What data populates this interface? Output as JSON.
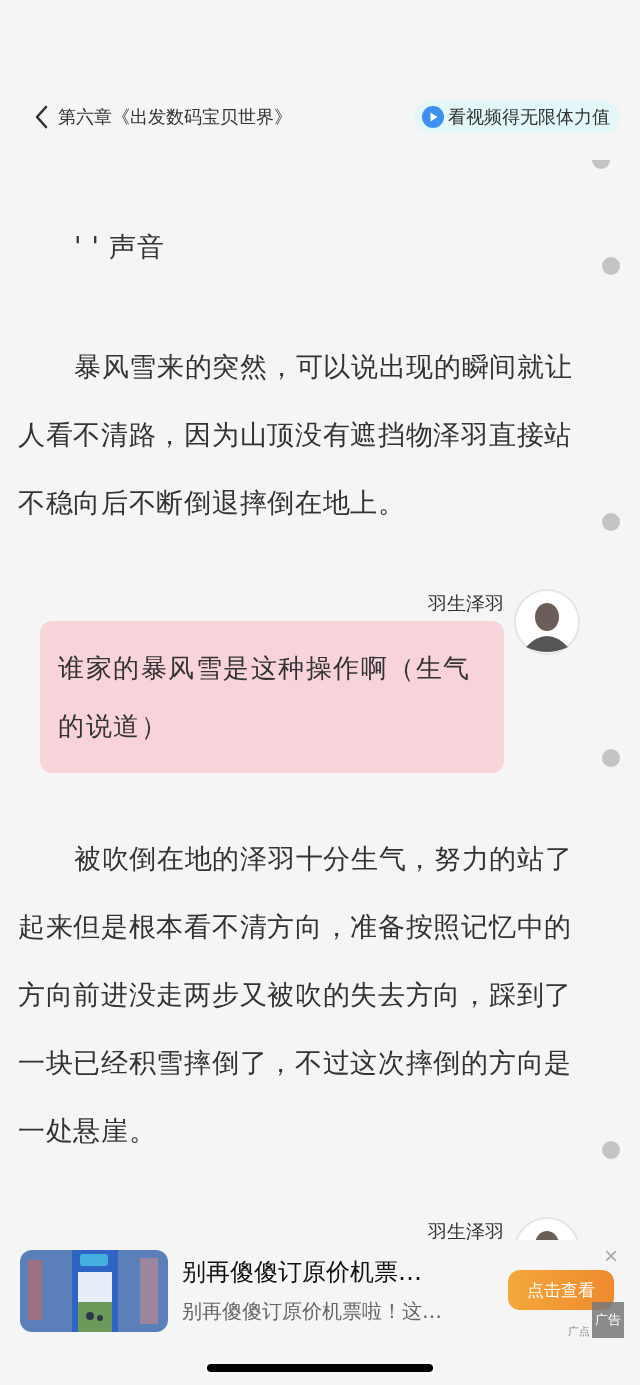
{
  "header": {
    "chapter_title": "第六章《出发数码宝贝世界》",
    "reward_button": "看视频得无限体力值"
  },
  "blocks": [
    {
      "kind": "paragraph",
      "text": "' ' 声音"
    },
    {
      "kind": "paragraph",
      "text": "暴风雪来的突然，可以说出现的瞬间就让人看不清路，因为山顶没有遮挡物泽羽直接站不稳向后不断倒退摔倒在地上。"
    },
    {
      "kind": "dialog",
      "speaker": "羽生泽羽",
      "text": "谁家的暴风雪是这种操作啊（生气的说道）"
    },
    {
      "kind": "paragraph",
      "text": "被吹倒在地的泽羽十分生气，努力的站了起来但是根本看不清方向，准备按照记忆中的方向前进没走两步又被吹的失去方向，踩到了一块已经积雪摔倒了，不过这次摔倒的方向是一处悬崖。"
    },
    {
      "kind": "dialog_cut",
      "speaker": "羽生泽羽"
    }
  ],
  "ad": {
    "title": "别再傻傻订原价机票…",
    "subtitle": "别再傻傻订原价机票啦！这…",
    "action": "点击查看",
    "close": "×",
    "badge": "广告",
    "source": "广点"
  }
}
